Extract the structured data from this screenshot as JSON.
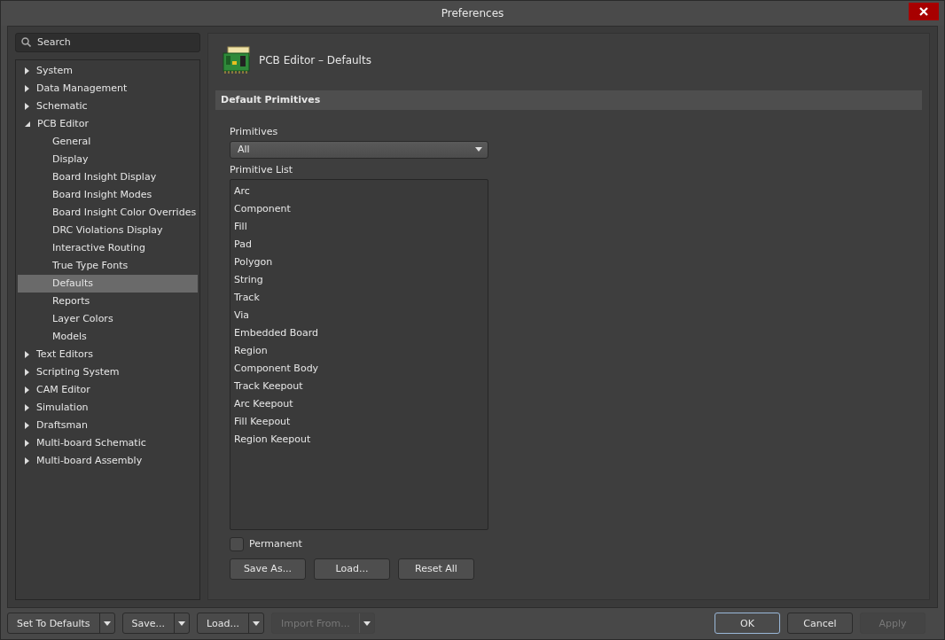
{
  "window": {
    "title": "Preferences"
  },
  "search": {
    "placeholder": "Search"
  },
  "tree": [
    {
      "label": "System",
      "expanded": false
    },
    {
      "label": "Data Management",
      "expanded": false
    },
    {
      "label": "Schematic",
      "expanded": false
    },
    {
      "label": "PCB Editor",
      "expanded": true,
      "children": [
        {
          "label": "General",
          "selected": false
        },
        {
          "label": "Display",
          "selected": false
        },
        {
          "label": "Board Insight Display",
          "selected": false
        },
        {
          "label": "Board Insight Modes",
          "selected": false
        },
        {
          "label": "Board Insight Color Overrides",
          "selected": false
        },
        {
          "label": "DRC Violations Display",
          "selected": false
        },
        {
          "label": "Interactive Routing",
          "selected": false
        },
        {
          "label": "True Type Fonts",
          "selected": false
        },
        {
          "label": "Defaults",
          "selected": true
        },
        {
          "label": "Reports",
          "selected": false
        },
        {
          "label": "Layer Colors",
          "selected": false
        },
        {
          "label": "Models",
          "selected": false
        }
      ]
    },
    {
      "label": "Text Editors",
      "expanded": false
    },
    {
      "label": "Scripting System",
      "expanded": false
    },
    {
      "label": "CAM Editor",
      "expanded": false
    },
    {
      "label": "Simulation",
      "expanded": false
    },
    {
      "label": "Draftsman",
      "expanded": false
    },
    {
      "label": "Multi-board Schematic",
      "expanded": false
    },
    {
      "label": "Multi-board Assembly",
      "expanded": false
    }
  ],
  "page": {
    "title": "PCB Editor – Defaults",
    "section": "Default Primitives",
    "primitives_label": "Primitives",
    "primitives_value": "All",
    "list_label": "Primitive List",
    "list": [
      "Arc",
      "Component",
      "Fill",
      "Pad",
      "Polygon",
      "String",
      "Track",
      "Via",
      "Embedded Board",
      "Region",
      "Component Body",
      "Track Keepout",
      "Arc Keepout",
      "Fill Keepout",
      "Region Keepout"
    ],
    "permanent": {
      "label": "Permanent",
      "checked": false
    },
    "buttons": [
      "Save As...",
      "Load...",
      "Reset All"
    ]
  },
  "footer": {
    "split_buttons": [
      {
        "label": "Set To Defaults",
        "disabled": false
      },
      {
        "label": "Save...",
        "disabled": false
      },
      {
        "label": "Load...",
        "disabled": false
      },
      {
        "label": "Import From...",
        "disabled": true
      }
    ],
    "buttons": [
      {
        "label": "OK",
        "disabled": false,
        "default": true
      },
      {
        "label": "Cancel",
        "disabled": false,
        "default": false
      },
      {
        "label": "Apply",
        "disabled": true,
        "default": false
      }
    ]
  }
}
